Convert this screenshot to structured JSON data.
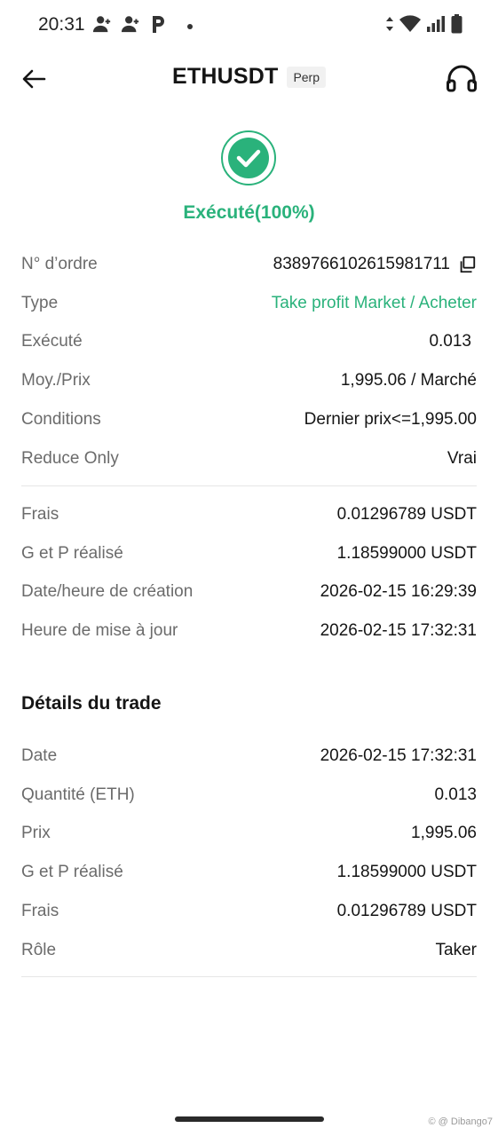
{
  "status_bar": {
    "time": "20:31",
    "left_icons": [
      "person-add-icon",
      "person-add-icon",
      "parking-icon",
      "dot-icon"
    ],
    "right_icons": [
      "data-arrows-icon",
      "wifi-icon",
      "signal-icon",
      "battery-icon"
    ]
  },
  "header": {
    "title": "ETHUSDT",
    "badge": "Perp",
    "back_icon": "arrow-left-icon",
    "support_icon": "headphones-icon"
  },
  "order_status": {
    "label": "Exécuté(100%)",
    "icon": "check-circle-icon",
    "color": "#2ab27b"
  },
  "order_details": [
    {
      "key": "N° d’ordre",
      "value": "8389766102615981711",
      "icon": "copy-icon"
    },
    {
      "key": "Type",
      "value": "Take profit Market / Acheter",
      "highlight": true
    },
    {
      "key": "Exécuté",
      "value": "0.013"
    },
    {
      "key": "Moy./Prix",
      "value": "1,995.06 / Marché"
    },
    {
      "key": "Conditions",
      "value": "Dernier prix<=1,995.00"
    },
    {
      "key": "Reduce Only",
      "value": "Vrai"
    }
  ],
  "fee_details": [
    {
      "key": "Frais",
      "value": "0.01296789 USDT"
    },
    {
      "key": "G et P réalisé",
      "value": "1.18599000 USDT"
    },
    {
      "key": "Date/heure de création",
      "value": "2026-02-15 16:29:39"
    },
    {
      "key": "Heure de mise à jour",
      "value": "2026-02-15 17:32:31"
    }
  ],
  "trade_section": {
    "title": "Détails du trade",
    "rows": [
      {
        "key": "Date",
        "value": "2026-02-15 17:32:31"
      },
      {
        "key": "Quantité (ETH)",
        "value": "0.013"
      },
      {
        "key": "Prix",
        "value": "1,995.06"
      },
      {
        "key": "G et P réalisé",
        "value": "1.18599000 USDT"
      },
      {
        "key": "Frais",
        "value": "0.01296789 USDT"
      },
      {
        "key": "Rôle",
        "value": "Taker"
      }
    ]
  },
  "watermark": "© @ Dibango7"
}
